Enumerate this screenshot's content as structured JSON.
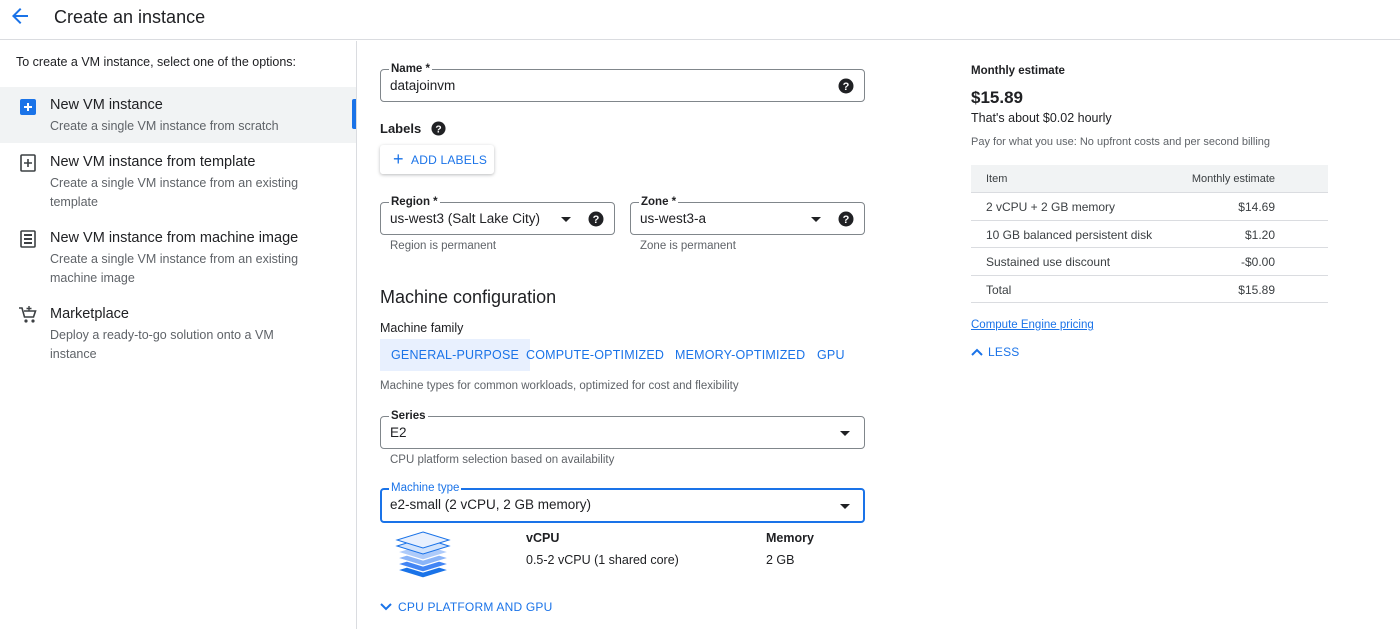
{
  "header": {
    "title": "Create an instance"
  },
  "left_panel": {
    "intro": "To create a VM instance, select one of the options:",
    "options": [
      {
        "title": "New VM instance",
        "desc": "Create a single VM instance from scratch",
        "icon": "add-box-icon",
        "selected": true
      },
      {
        "title": "New VM instance from template",
        "desc": "Create a single VM instance from an existing template",
        "icon": "template-add-icon",
        "selected": false
      },
      {
        "title": "New VM instance from machine image",
        "desc": "Create a single VM instance from an existing machine image",
        "icon": "machine-image-icon",
        "selected": false
      },
      {
        "title": "Marketplace",
        "desc": "Deploy a ready-to-go solution onto a VM instance",
        "icon": "marketplace-cart-icon",
        "selected": false
      }
    ]
  },
  "form": {
    "name": {
      "label": "Name *",
      "value": "datajoinvm"
    },
    "labels": {
      "title": "Labels",
      "add_button": "ADD LABELS"
    },
    "region": {
      "label": "Region *",
      "value": "us-west3 (Salt Lake City)",
      "hint": "Region is permanent"
    },
    "zone": {
      "label": "Zone *",
      "value": "us-west3-a",
      "hint": "Zone is permanent"
    },
    "machine_config": {
      "title": "Machine configuration",
      "family_label": "Machine family",
      "tabs": [
        "GENERAL-PURPOSE",
        "COMPUTE-OPTIMIZED",
        "MEMORY-OPTIMIZED",
        "GPU"
      ],
      "active_tab": "GENERAL-PURPOSE",
      "family_desc": "Machine types for common workloads, optimized for cost and flexibility",
      "series": {
        "label": "Series",
        "value": "E2",
        "hint": "CPU platform selection based on availability"
      },
      "machine_type": {
        "label": "Machine type",
        "value": "e2-small (2 vCPU, 2 GB memory)"
      },
      "specs": {
        "vcpu_label": "vCPU",
        "vcpu_value": "0.5-2 vCPU (1 shared core)",
        "memory_label": "Memory",
        "memory_value": "2 GB"
      },
      "cpu_platform_link": "CPU PLATFORM AND GPU"
    }
  },
  "estimate": {
    "title": "Monthly estimate",
    "price": "$15.89",
    "hourly": "That's about $0.02 hourly",
    "note": "Pay for what you use: No upfront costs and per second billing",
    "table_headers": [
      "Item",
      "Monthly estimate"
    ],
    "rows": [
      {
        "item": "2 vCPU + 2 GB memory",
        "cost": "$14.69"
      },
      {
        "item": "10 GB balanced persistent disk",
        "cost": "$1.20"
      },
      {
        "item": "Sustained use discount",
        "cost": "-$0.00"
      },
      {
        "item": "Total",
        "cost": "$15.89"
      }
    ],
    "pricing_link": "Compute Engine pricing",
    "less_button": "LESS"
  },
  "colors": {
    "accent": "#1a73e8",
    "text": "#202124",
    "muted": "#5f6368",
    "border": "#dadce0"
  }
}
